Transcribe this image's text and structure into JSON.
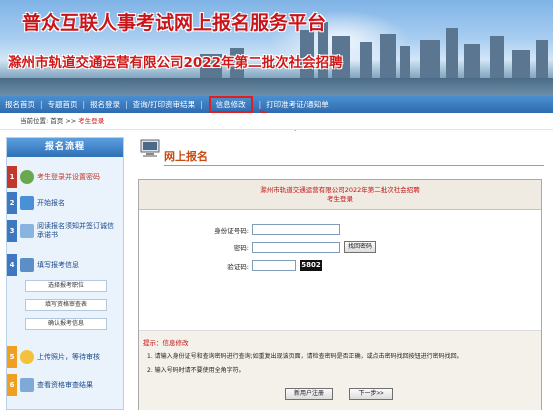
{
  "banner": {
    "title": "普众互联人事考试网上报名服务平台",
    "subtitle": "滁州市轨道交通运营有限公司2022年第二批次社会招聘"
  },
  "nav": {
    "items": [
      "报名首页",
      "专题首页",
      "报名登录",
      "查询/打印资审结果",
      "信息修改",
      "打印准考证/通知单"
    ],
    "separator": "|",
    "active_index": 4
  },
  "breadcrumb": {
    "prefix": "当前位置: 首页 >> ",
    "current": "考生登录"
  },
  "sidebar": {
    "title": "报名流程",
    "steps": [
      {
        "num": "1",
        "label": "考生登录并设置密码",
        "color": "#c0392b"
      },
      {
        "num": "2",
        "label": "开始报名",
        "color": "#3d78c0"
      },
      {
        "num": "3",
        "label": "阅读报名须知并签订诚信承诺书",
        "color": "#3d78c0"
      },
      {
        "num": "4",
        "label": "填写报考信息",
        "color": "#3d78c0"
      },
      {
        "num": "5",
        "label": "上传照片，等待审核",
        "color": "#f0a020"
      },
      {
        "num": "6",
        "label": "查看资格审查结果",
        "color": "#f0a020"
      }
    ],
    "sub_buttons": [
      "选择报考职位",
      "填写资格审查表",
      "确认报考信息"
    ]
  },
  "content": {
    "title": "网上报名",
    "box_title_line1": "滁州市轨道交通运营有限公司2022年第二批次社会招聘",
    "box_title_line2": "考生登录",
    "form": {
      "id_label": "身份证号码:",
      "pwd_label": "密码:",
      "captcha_label": "验证码:",
      "find_pwd_button": "找回密码",
      "captcha_value": "5802",
      "register_button": "新用户注册",
      "next_button": "下一步>>"
    },
    "tips_label": "提示：信息修改",
    "tips": [
      "1.   请输入身份证号和查询密码进行查询;如重复出现该页面，请检查密码是否正确，或点击密码找回按钮进行密码找回。",
      "2.   输入号码时请不要使用全角字符。"
    ]
  },
  "colors": {
    "nav_bg": "#3a7cc3",
    "title_red": "#c8141b",
    "highlight": "#e01e1e",
    "content_title": "#c84a10"
  }
}
